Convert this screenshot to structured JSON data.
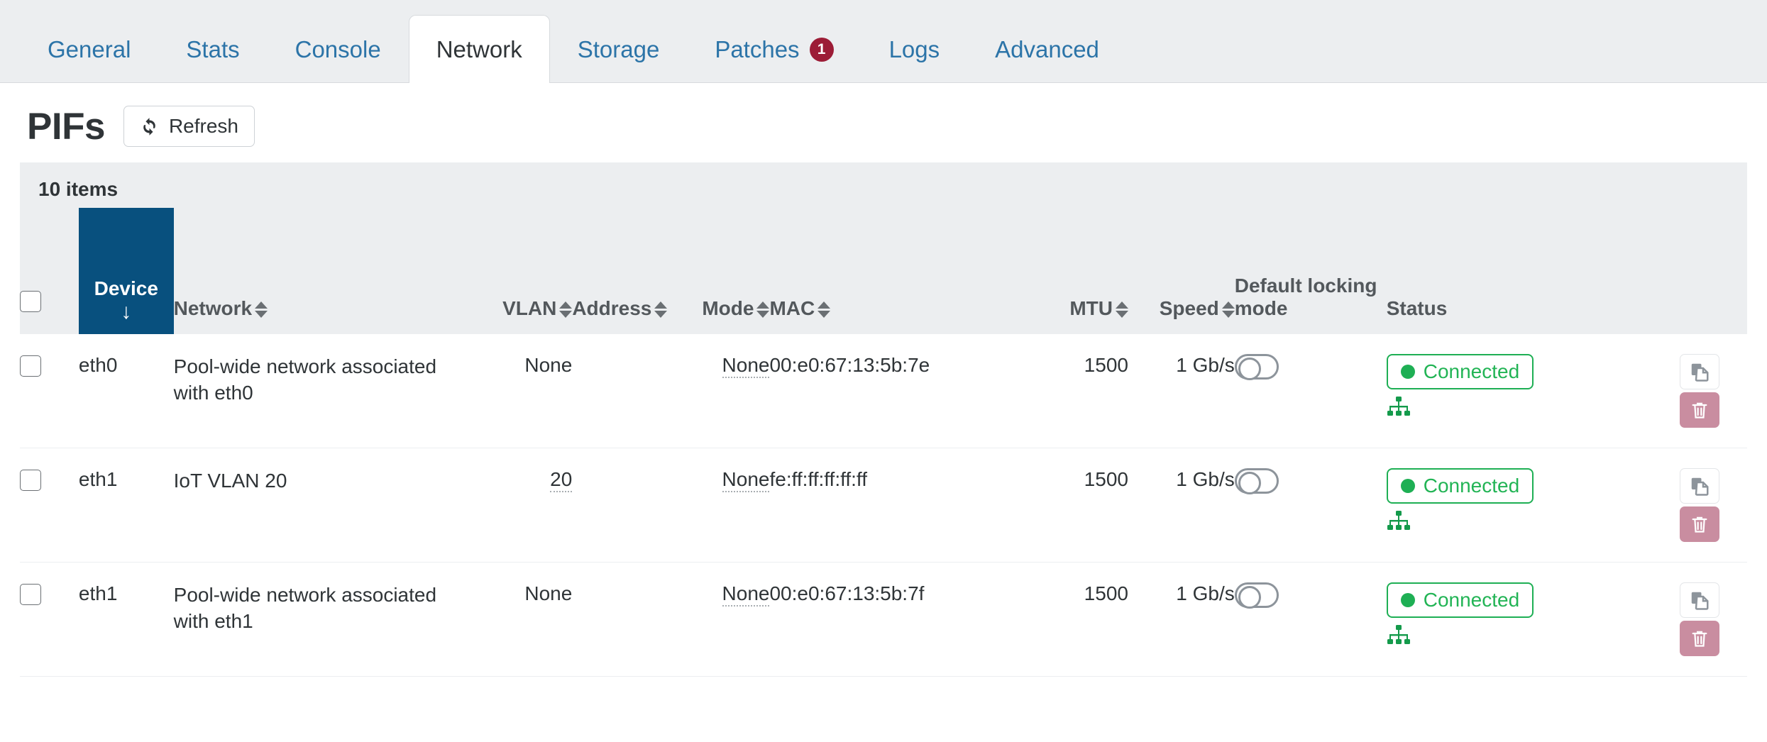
{
  "tabs": [
    {
      "label": "General",
      "active": false,
      "badge": null
    },
    {
      "label": "Stats",
      "active": false,
      "badge": null
    },
    {
      "label": "Console",
      "active": false,
      "badge": null
    },
    {
      "label": "Network",
      "active": true,
      "badge": null
    },
    {
      "label": "Storage",
      "active": false,
      "badge": null
    },
    {
      "label": "Patches",
      "active": false,
      "badge": "1"
    },
    {
      "label": "Logs",
      "active": false,
      "badge": null
    },
    {
      "label": "Advanced",
      "active": false,
      "badge": null
    }
  ],
  "page": {
    "title": "PIFs",
    "refresh_label": "Refresh",
    "refresh_icon": "refresh-icon",
    "items_count": "10 items"
  },
  "table": {
    "sort_column": "Device",
    "sort_direction": "descending-arrow",
    "columns": [
      {
        "key": "select",
        "label": "",
        "sortable": false,
        "align": "left"
      },
      {
        "key": "device",
        "label": "Device",
        "sortable": true,
        "align": "center",
        "sorted": true
      },
      {
        "key": "network",
        "label": "Network",
        "sortable": true,
        "align": "left"
      },
      {
        "key": "vlan",
        "label": "VLAN",
        "sortable": true,
        "align": "right"
      },
      {
        "key": "address",
        "label": "Address",
        "sortable": true,
        "align": "left"
      },
      {
        "key": "mode",
        "label": "Mode",
        "sortable": true,
        "align": "right"
      },
      {
        "key": "mac",
        "label": "MAC",
        "sortable": true,
        "align": "left"
      },
      {
        "key": "mtu",
        "label": "MTU",
        "sortable": true,
        "align": "right"
      },
      {
        "key": "speed",
        "label": "Speed",
        "sortable": true,
        "align": "right"
      },
      {
        "key": "locking",
        "label": "Default locking mode",
        "sortable": false,
        "align": "left"
      },
      {
        "key": "status",
        "label": "Status",
        "sortable": false,
        "align": "left"
      },
      {
        "key": "actions",
        "label": "",
        "sortable": false,
        "align": "right"
      }
    ],
    "rows": [
      {
        "device": "eth0",
        "network": "Pool-wide network associated with eth0",
        "vlan": "None",
        "vlan_dotted": false,
        "address": "",
        "mode": "None",
        "mode_dotted": true,
        "mac": "00:e0:67:13:5b:7e",
        "mtu": "1500",
        "speed": "1 Gb/s",
        "locking_toggle": "off",
        "status": "Connected",
        "status_icon": "network-sitemap-icon",
        "copy_label": "copy-icon",
        "delete_label": "trash-icon"
      },
      {
        "device": "eth1",
        "network": "IoT VLAN 20",
        "vlan": "20",
        "vlan_dotted": true,
        "address": "",
        "mode": "None",
        "mode_dotted": true,
        "mac": "fe:ff:ff:ff:ff:ff",
        "mtu": "1500",
        "speed": "1 Gb/s",
        "locking_toggle": "off",
        "status": "Connected",
        "status_icon": "network-sitemap-icon",
        "copy_label": "copy-icon",
        "delete_label": "trash-icon"
      },
      {
        "device": "eth1",
        "network": "Pool-wide network associated with eth1",
        "vlan": "None",
        "vlan_dotted": false,
        "address": "",
        "mode": "None",
        "mode_dotted": true,
        "mac": "00:e0:67:13:5b:7f",
        "mtu": "1500",
        "speed": "1 Gb/s",
        "locking_toggle": "off",
        "status": "Connected",
        "status_icon": "network-sitemap-icon",
        "copy_label": "copy-icon",
        "delete_label": "trash-icon"
      }
    ]
  },
  "colors": {
    "tab_link": "#2c74a8",
    "tab_bar_bg": "#eceef0",
    "sorted_header_bg": "#08507e",
    "badge_red": "#9c1c36",
    "status_green": "#1eaf54",
    "delete_pink": "#c98da0"
  }
}
